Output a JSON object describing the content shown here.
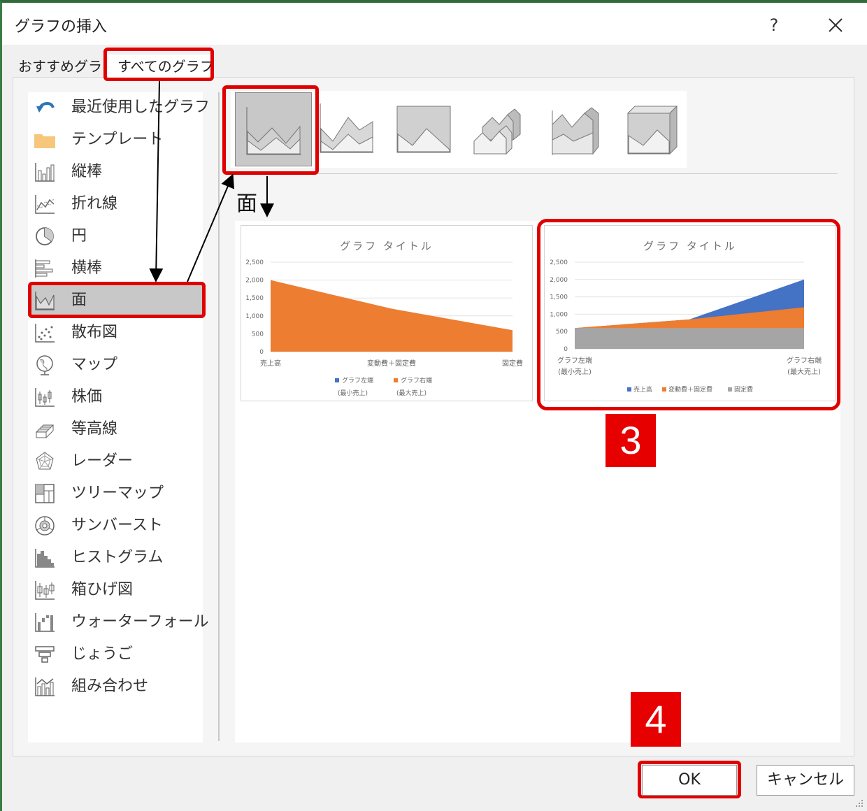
{
  "dialog": {
    "title": "グラフの挿入",
    "help": "?",
    "tabs": {
      "recommended": "おすすめグラフ",
      "all": "すべてのグラフ"
    }
  },
  "sidebar": {
    "items": [
      {
        "label": "最近使用したグラフ",
        "icon": "recent-icon"
      },
      {
        "label": "テンプレート",
        "icon": "folder-icon"
      },
      {
        "label": "縦棒",
        "icon": "column-chart-icon"
      },
      {
        "label": "折れ線",
        "icon": "line-chart-icon"
      },
      {
        "label": "円",
        "icon": "pie-chart-icon"
      },
      {
        "label": "横棒",
        "icon": "bar-chart-icon"
      },
      {
        "label": "面",
        "icon": "area-chart-icon",
        "selected": true
      },
      {
        "label": "散布図",
        "icon": "scatter-chart-icon"
      },
      {
        "label": "マップ",
        "icon": "map-chart-icon"
      },
      {
        "label": "株価",
        "icon": "stock-chart-icon"
      },
      {
        "label": "等高線",
        "icon": "surface-chart-icon"
      },
      {
        "label": "レーダー",
        "icon": "radar-chart-icon"
      },
      {
        "label": "ツリーマップ",
        "icon": "treemap-chart-icon"
      },
      {
        "label": "サンバースト",
        "icon": "sunburst-chart-icon"
      },
      {
        "label": "ヒストグラム",
        "icon": "histogram-chart-icon"
      },
      {
        "label": "箱ひげ図",
        "icon": "box-whisker-chart-icon"
      },
      {
        "label": "ウォーターフォール",
        "icon": "waterfall-chart-icon"
      },
      {
        "label": "じょうご",
        "icon": "funnel-chart-icon"
      },
      {
        "label": "組み合わせ",
        "icon": "combo-chart-icon"
      }
    ]
  },
  "subtype_name": "面",
  "preview1": {
    "title": "グラフ タイトル",
    "yticks": [
      "2,500",
      "2,000",
      "1,500",
      "1,000",
      "500",
      "0"
    ],
    "xlabels": [
      "売上高",
      "変動費＋固定費",
      "固定費"
    ],
    "legend": [
      {
        "line1": "グラフ左端",
        "line2": "(最小売上)",
        "color": "#4472c4"
      },
      {
        "line1": "グラフ右端",
        "line2": "(最大売上)",
        "color": "#ed7d31"
      }
    ]
  },
  "preview2": {
    "title": "グラフ タイトル",
    "yticks": [
      "2,500",
      "2,000",
      "1,500",
      "1,000",
      "500",
      "0"
    ],
    "xlabels": [
      {
        "line1": "グラフ左端",
        "line2": "(最小売上)"
      },
      {
        "line1": "グラフ右端",
        "line2": "(最大売上)"
      }
    ],
    "legend": [
      {
        "label": "売上高",
        "color": "#4472c4"
      },
      {
        "label": "変動費＋固定費",
        "color": "#ed7d31"
      },
      {
        "label": "固定費",
        "color": "#a5a5a5"
      }
    ]
  },
  "chart_data": [
    {
      "type": "area",
      "title": "グラフ タイトル",
      "categories": [
        "売上高",
        "変動費＋固定費",
        "固定費"
      ],
      "ylim": [
        0,
        2500
      ],
      "series": [
        {
          "name": "グラフ左端(最小売上)",
          "values": [
            0,
            0,
            0
          ]
        },
        {
          "name": "グラフ右端(最大売上)",
          "values": [
            2000,
            1200,
            600
          ]
        }
      ]
    },
    {
      "type": "area",
      "title": "グラフ タイトル",
      "categories": [
        "グラフ左端(最小売上)",
        "",
        "グラフ右端(最大売上)"
      ],
      "ylim": [
        0,
        2500
      ],
      "series": [
        {
          "name": "売上高",
          "values": [
            600,
            850,
            2000
          ]
        },
        {
          "name": "変動費＋固定費",
          "values": [
            600,
            850,
            1200
          ]
        },
        {
          "name": "固定費",
          "values": [
            600,
            600,
            600
          ]
        }
      ]
    }
  ],
  "annotations": {
    "step3": "3",
    "step4": "4"
  },
  "buttons": {
    "ok": "OK",
    "cancel": "キャンセル"
  },
  "colors": {
    "highlight": "#e00000",
    "blue": "#4472c4",
    "orange": "#ed7d31",
    "gray": "#a5a5a5"
  }
}
